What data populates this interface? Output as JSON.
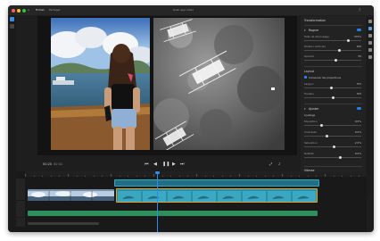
{
  "window": {
    "title": "Rush app video",
    "tabs": [
      "Fichier",
      "Partager"
    ]
  },
  "viewer": {
    "left_photo": "woman-in-hat-at-shore",
    "right_photo": "aerial-boats-on-reef"
  },
  "transport": {
    "timecode": "00:20",
    "duration": "00:31"
  },
  "panel": {
    "title": "Transformation",
    "section_crop": {
      "label": "Rogner",
      "rows": [
        {
          "label": "Taille de découpage",
          "value": "375%",
          "pct": 0.78
        },
        {
          "label": "Position verticale",
          "value": "100",
          "pct": 0.62
        },
        {
          "label": "Opacité",
          "value": "55",
          "pct": 0.55
        }
      ]
    },
    "section_layout": {
      "label": "Layout",
      "option": "Conserver les proportions",
      "rows": [
        {
          "label": "Largeur",
          "value": "753",
          "pct": 0.48
        },
        {
          "label": "Hauteur",
          "value": "763",
          "pct": 0.5
        }
      ]
    },
    "section_adjust": {
      "label": "Ajuster",
      "group": "Ajustage",
      "rows": [
        {
          "label": "Exposition",
          "value": "0,5%",
          "pct": 0.3
        },
        {
          "label": "Contraste",
          "value": "0,5%",
          "pct": 0.4
        },
        {
          "label": "Saturation",
          "value": "2,5%",
          "pct": 0.52
        },
        {
          "label": "Netteté",
          "value": "0,5%",
          "pct": 0.64
        }
      ]
    },
    "section_speed": {
      "label": "Vitesse",
      "rows": [
        {
          "label": "Vitesse",
          "value": "100 %",
          "pct": 0.5
        },
        {
          "label": "Temps d'inversion",
          "value": "0",
          "pct": 0.12
        }
      ]
    }
  },
  "colors": {
    "accent": "#2680eb",
    "clip_selected_border": "#e6a51a",
    "clip_underwater": "#2b8fa8",
    "audio_track": "#2f8f5c"
  }
}
